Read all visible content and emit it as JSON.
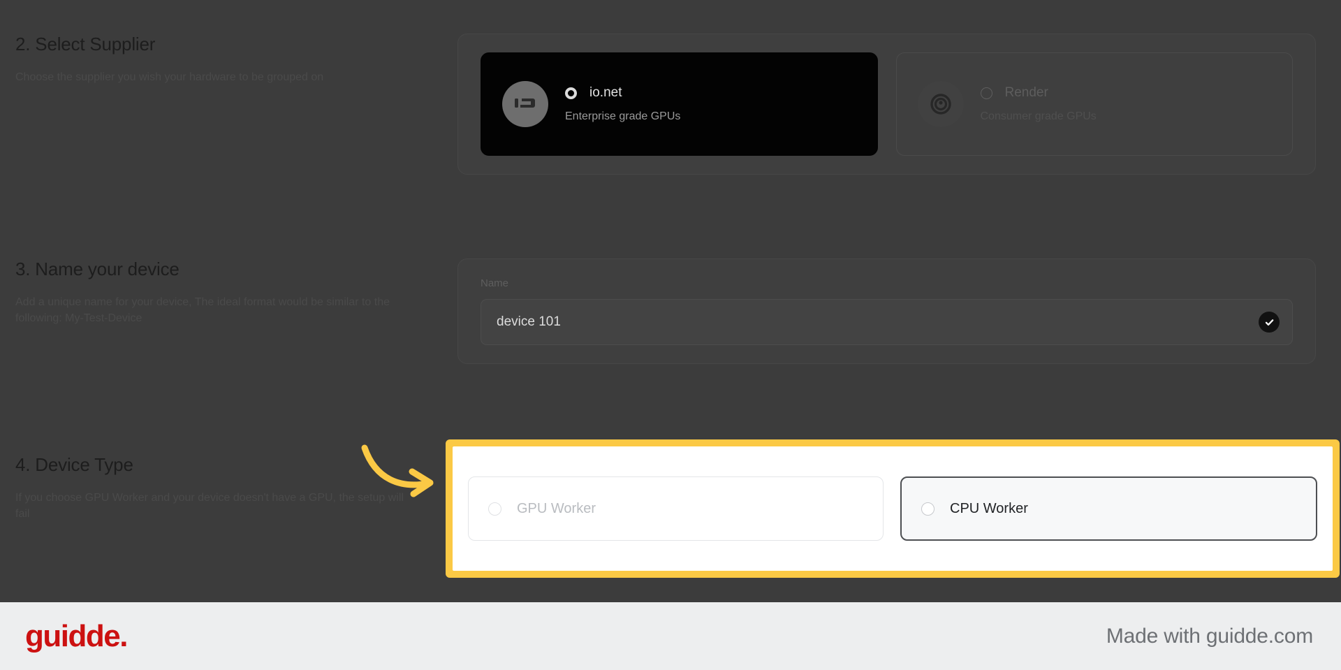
{
  "theme": {
    "backdrop": "#3c3c3c",
    "highlight_yellow": "#FBC945",
    "brand_red": "#CC1111",
    "footer_bg": "#edeeef"
  },
  "steps": {
    "supplier": {
      "title": "2. Select Supplier",
      "description": "Choose the supplier you wish your hardware to be grouped on",
      "options": [
        {
          "name": "io.net",
          "subtitle": "Enterprise grade GPUs",
          "selected": "true",
          "logo": "ionet-logo-icon"
        },
        {
          "name": "Render",
          "subtitle": "Consumer grade GPUs",
          "selected": "false",
          "logo": "render-logo-icon"
        }
      ]
    },
    "device_name": {
      "title": "3. Name your device",
      "description": "Add a unique name for your device, The ideal format would be similar to the following: My-Test-Device",
      "field_label": "Name",
      "value": "device 101",
      "placeholder": "My-Test-Device",
      "valid_icon": "check-circle-icon"
    },
    "device_type": {
      "title": "4. Device Type",
      "description": "If you choose GPU Worker and your device doesn't have a GPU, the setup will fail",
      "options": [
        {
          "label": "GPU Worker",
          "state": "plain"
        },
        {
          "label": "CPU Worker",
          "state": "focused"
        }
      ]
    }
  },
  "annotation": {
    "arrow": "curved-arrow-icon"
  },
  "footer": {
    "brand": "guidde.",
    "made_with": "Made with guidde.com"
  }
}
